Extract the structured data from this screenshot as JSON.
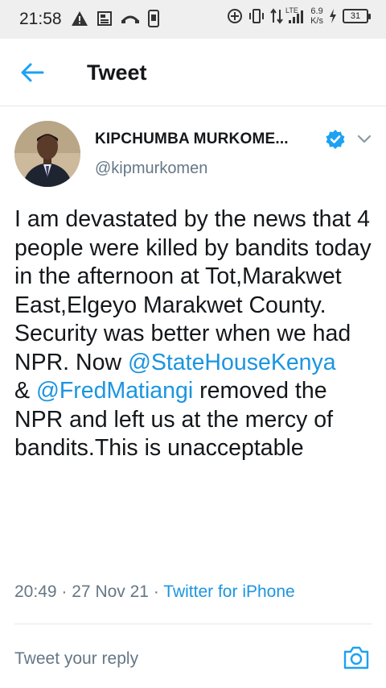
{
  "status_bar": {
    "time": "21:58",
    "network_type": "LTE",
    "net_speed_value": "6.9",
    "net_speed_unit": "K/s",
    "battery_level": "31",
    "left_icons": [
      "warning-icon",
      "news-icon",
      "missed-call-icon",
      "phone-icon"
    ],
    "right_icons": [
      "data-saver-icon",
      "vibrate-icon",
      "data-transfer-icon",
      "signal-icon",
      "charging-icon"
    ]
  },
  "header": {
    "title": "Tweet",
    "back_icon": "arrow-left-icon",
    "accent_color": "#1da1f2"
  },
  "tweet": {
    "author_name": "KIPCHUMBA MURKOME...",
    "handle": "@kipmurkomen",
    "verified": true,
    "text_part1": "I am devastated by the news that 4 people were killed by bandits today in the afternoon at Tot,Marakwet East,Elgeyo Marakwet County. Security was better when we had NPR. Now ",
    "mention1": "@StateHouseKenya",
    "text_part2": "\n& ",
    "mention2": "@FredMatiangi",
    "text_part3": " removed the NPR and left us at the mercy of bandits.This is unacceptable",
    "time": "20:49",
    "separator": "·",
    "date": "27 Nov 21",
    "source": "Twitter for iPhone",
    "link_color": "#1b95e0"
  },
  "reply": {
    "placeholder": "Tweet your reply",
    "camera_icon": "camera-icon"
  }
}
